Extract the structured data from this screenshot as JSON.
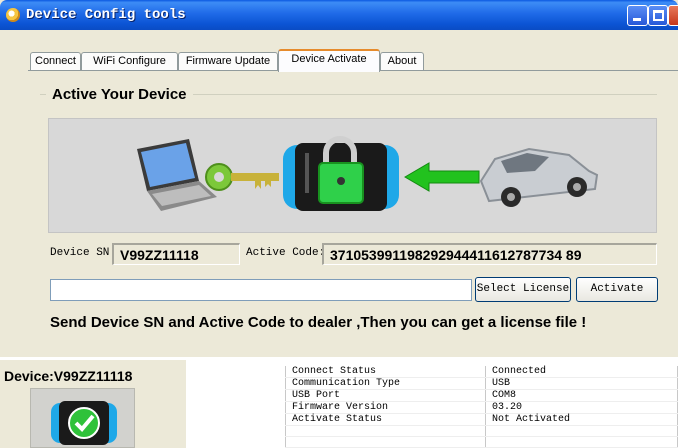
{
  "window": {
    "title": "Device Config tools"
  },
  "tabs": [
    {
      "label": "Connect"
    },
    {
      "label": "WiFi Configure"
    },
    {
      "label": "Firmware Update"
    },
    {
      "label": "Device Activate"
    },
    {
      "label": "About"
    }
  ],
  "activate": {
    "group_title": "Active Your Device",
    "device_sn_label": "Device SN:",
    "device_sn_value": "V99ZZ11118",
    "active_code_label": "Active Code:",
    "active_code_value": "371053991198292944411612787734 89",
    "license_path_value": "",
    "select_license_label": "Select License",
    "activate_label": "Activate",
    "notice": "Send Device SN and Active Code to dealer ,Then you can get a license file !"
  },
  "device": {
    "title": "Device:V99ZZ11118"
  },
  "status": {
    "rows": [
      {
        "key": "Connect Status",
        "value": "Connected"
      },
      {
        "key": "Communication Type",
        "value": "USB"
      },
      {
        "key": "USB Port",
        "value": "COM8"
      },
      {
        "key": "Firmware Version",
        "value": "03.20"
      },
      {
        "key": "Activate Status",
        "value": "Not Activated"
      },
      {
        "key": "",
        "value": ""
      },
      {
        "key": "",
        "value": ""
      }
    ]
  },
  "colors": {
    "titlebar": "#1f6ae8",
    "tab_accent": "#e68b2c",
    "lock_green": "#2fd04a",
    "arrow_green": "#22c21e",
    "device_blue": "#1fa8e8"
  }
}
